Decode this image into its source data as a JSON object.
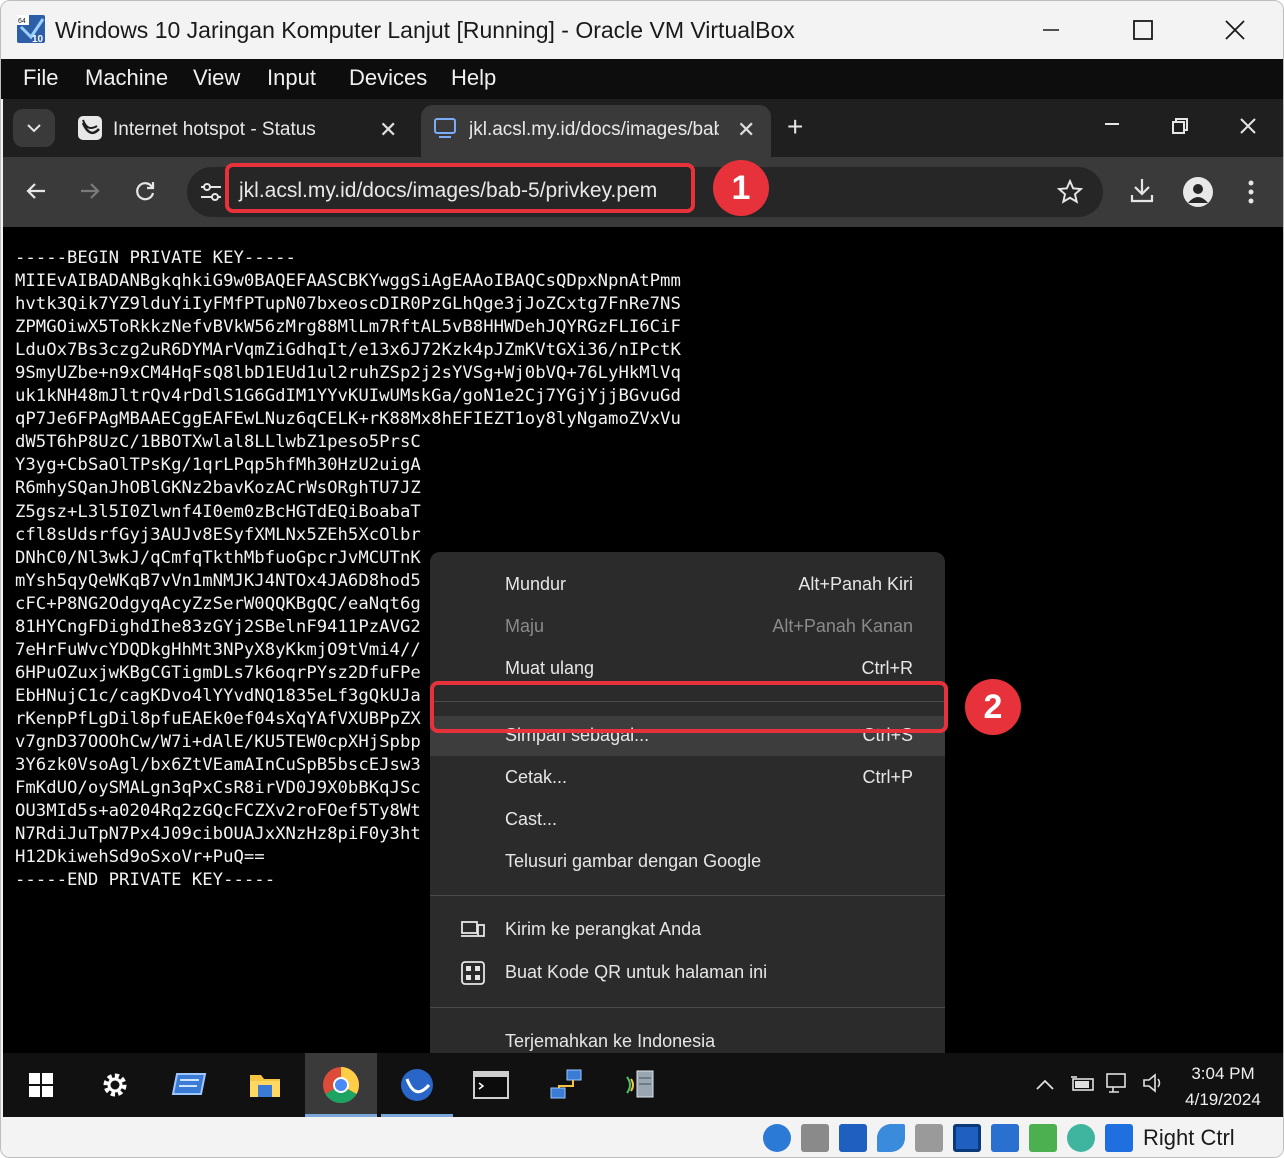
{
  "window": {
    "title": "Windows 10 Jaringan Komputer Lanjut [Running] - Oracle VM VirtualBox",
    "icon": "virtualbox-logo-icon",
    "icon_badge_64": "64",
    "icon_badge_10": "10"
  },
  "vbox_menu": [
    "File",
    "Machine",
    "View",
    "Input",
    "Devices",
    "Help"
  ],
  "browser": {
    "tabs": [
      {
        "title": "Internet hotspot - Status",
        "icon": "hotspot-icon",
        "active": false
      },
      {
        "title": "jkl.acsl.my.id/docs/images/bab",
        "icon": "page-icon",
        "active": true
      }
    ],
    "url": "jkl.acsl.my.id/docs/images/bab-5/privkey.pem"
  },
  "annotations": {
    "badge_1": "1",
    "badge_2": "2",
    "color": "#e8323b"
  },
  "pem_lines": [
    "-----BEGIN PRIVATE KEY-----",
    "MIIEvAIBADANBgkqhkiG9w0BAQEFAASCBKYwggSiAgEAAoIBAQCsQDpxNpnAtPmm",
    "hvtk3Qik7YZ9lduYiIyFMfPTupN07bxeoscDIR0PzGLhQge3jJoZCxtg7FnRe7NS",
    "ZPMGOiwX5ToRkkzNefvBVkW56zMrg88MlLm7RftAL5vB8HHWDehJQYRGzFLI6CiF",
    "LduOx7Bs3czg2uR6DYMArVqmZiGdhqIt/e13x6J72Kzk4pJZmKVtGXi36/nIPctK",
    "9SmyUZbe+n9xCM4HqFsQ8lbD1EUd1ul2ruhZSp2j2sYVSg+Wj0bVQ+76LyHkMlVq",
    "uk1kNH48mJltrQv4rDdlS1G6GdIM1YYvKUIwUMskGa/goN1e2Cj7YGjYjjBGvuGd",
    "qP7Je6FPAgMBAAECggEAFEwLNuz6qCELK+rK88Mx8hEFIEZT1oy8lyNgamoZVxVu",
    "dW5T6hP8UzC/1BBOTXwlal8LLlwbZ1peso5PrsC",
    "Y3yg+CbSaOlTPsKg/1qrLPqp5hfMh30HzU2uigA",
    "R6mhySQanJhOBlGKNz2bavKozACrWsORghTU7JZ",
    "Z5gsz+L3l5I0Zlwnf4I0em0zBcHGTdEQiBoabaT",
    "cfl8sUdsrfGyj3AUJv8ESyfXMLNx5ZEh5XcOlbr",
    "DNhC0/Nl3wkJ/qCmfqTkthMbfuoGpcrJvMCUTnK",
    "mYsh5qyQeWKqB7vVn1mNMJKJ4NTOx4JA6D8hod5",
    "cFC+P8NG2OdgyqAcyZzSerW0QQKBgQC/eaNqt6g",
    "81HYCngFDighdIhe83zGYj2SBelnF9411PzAVG2",
    "7eHrFuWvcYDQDkgHhMt3NPyX8yKkmjO9tVmi4//",
    "6HPuOZuxjwKBgCGTigmDLs7k6oqrPYsz2DfuFPe",
    "EbHNujC1c/cagKDvo4lYYvdNQ1835eLf3gQkUJa",
    "rKenpPfLgDil8pfuEAEk0ef04sXqYAfVXUBPpZX",
    "v7gnD37OOOhCw/W7i+dAlE/KU5TEW0cpXHjSpbp",
    "3Y6zk0VsoAgl/bx6ZtVEamAInCuSpB5bscEJsw3",
    "FmKdUO/oySMALgn3qPxCsR8irVD0J9X0bBKqJSc",
    "OU3MId5s+a0204Rq2zGQcFCZXv2roFOef5Ty8Wt",
    "N7RdiJuTpN7Px4J09cibOUAJxXNzHz8piF0y3ht",
    "H12DkiwehSd9oSxoVr+PuQ==",
    "-----END PRIVATE KEY-----"
  ],
  "context_menu": {
    "back": {
      "label": "Mundur",
      "shortcut": "Alt+Panah Kiri"
    },
    "forward": {
      "label": "Maju",
      "shortcut": "Alt+Panah Kanan"
    },
    "reload": {
      "label": "Muat ulang",
      "shortcut": "Ctrl+R"
    },
    "save_as": {
      "label": "Simpan sebagai...",
      "shortcut": "Ctrl+S"
    },
    "print": {
      "label": "Cetak...",
      "shortcut": "Ctrl+P"
    },
    "cast": {
      "label": "Cast..."
    },
    "search_image": {
      "label": "Telusuri gambar dengan Google"
    },
    "send_device": {
      "label": "Kirim ke perangkat Anda"
    },
    "qr_code": {
      "label": "Buat Kode QR untuk halaman ini"
    },
    "translate": {
      "label": "Terjemahkan ke Indonesia"
    }
  },
  "taskbar": {
    "time": "3:04 PM",
    "date": "4/19/2024"
  },
  "vbox_status": {
    "host_key": "Right Ctrl"
  }
}
